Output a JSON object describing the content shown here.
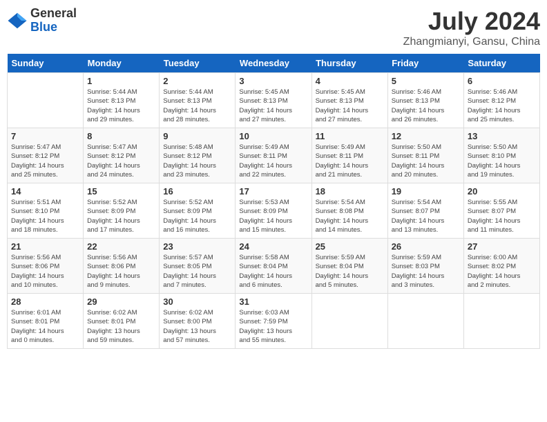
{
  "header": {
    "logo_general": "General",
    "logo_blue": "Blue",
    "title": "July 2024",
    "location": "Zhangmianyi, Gansu, China"
  },
  "days_of_week": [
    "Sunday",
    "Monday",
    "Tuesday",
    "Wednesday",
    "Thursday",
    "Friday",
    "Saturday"
  ],
  "weeks": [
    [
      {
        "day": "",
        "info": ""
      },
      {
        "day": "1",
        "info": "Sunrise: 5:44 AM\nSunset: 8:13 PM\nDaylight: 14 hours\nand 29 minutes."
      },
      {
        "day": "2",
        "info": "Sunrise: 5:44 AM\nSunset: 8:13 PM\nDaylight: 14 hours\nand 28 minutes."
      },
      {
        "day": "3",
        "info": "Sunrise: 5:45 AM\nSunset: 8:13 PM\nDaylight: 14 hours\nand 27 minutes."
      },
      {
        "day": "4",
        "info": "Sunrise: 5:45 AM\nSunset: 8:13 PM\nDaylight: 14 hours\nand 27 minutes."
      },
      {
        "day": "5",
        "info": "Sunrise: 5:46 AM\nSunset: 8:13 PM\nDaylight: 14 hours\nand 26 minutes."
      },
      {
        "day": "6",
        "info": "Sunrise: 5:46 AM\nSunset: 8:12 PM\nDaylight: 14 hours\nand 25 minutes."
      }
    ],
    [
      {
        "day": "7",
        "info": "Sunrise: 5:47 AM\nSunset: 8:12 PM\nDaylight: 14 hours\nand 25 minutes."
      },
      {
        "day": "8",
        "info": "Sunrise: 5:47 AM\nSunset: 8:12 PM\nDaylight: 14 hours\nand 24 minutes."
      },
      {
        "day": "9",
        "info": "Sunrise: 5:48 AM\nSunset: 8:12 PM\nDaylight: 14 hours\nand 23 minutes."
      },
      {
        "day": "10",
        "info": "Sunrise: 5:49 AM\nSunset: 8:11 PM\nDaylight: 14 hours\nand 22 minutes."
      },
      {
        "day": "11",
        "info": "Sunrise: 5:49 AM\nSunset: 8:11 PM\nDaylight: 14 hours\nand 21 minutes."
      },
      {
        "day": "12",
        "info": "Sunrise: 5:50 AM\nSunset: 8:11 PM\nDaylight: 14 hours\nand 20 minutes."
      },
      {
        "day": "13",
        "info": "Sunrise: 5:50 AM\nSunset: 8:10 PM\nDaylight: 14 hours\nand 19 minutes."
      }
    ],
    [
      {
        "day": "14",
        "info": "Sunrise: 5:51 AM\nSunset: 8:10 PM\nDaylight: 14 hours\nand 18 minutes."
      },
      {
        "day": "15",
        "info": "Sunrise: 5:52 AM\nSunset: 8:09 PM\nDaylight: 14 hours\nand 17 minutes."
      },
      {
        "day": "16",
        "info": "Sunrise: 5:52 AM\nSunset: 8:09 PM\nDaylight: 14 hours\nand 16 minutes."
      },
      {
        "day": "17",
        "info": "Sunrise: 5:53 AM\nSunset: 8:09 PM\nDaylight: 14 hours\nand 15 minutes."
      },
      {
        "day": "18",
        "info": "Sunrise: 5:54 AM\nSunset: 8:08 PM\nDaylight: 14 hours\nand 14 minutes."
      },
      {
        "day": "19",
        "info": "Sunrise: 5:54 AM\nSunset: 8:07 PM\nDaylight: 14 hours\nand 13 minutes."
      },
      {
        "day": "20",
        "info": "Sunrise: 5:55 AM\nSunset: 8:07 PM\nDaylight: 14 hours\nand 11 minutes."
      }
    ],
    [
      {
        "day": "21",
        "info": "Sunrise: 5:56 AM\nSunset: 8:06 PM\nDaylight: 14 hours\nand 10 minutes."
      },
      {
        "day": "22",
        "info": "Sunrise: 5:56 AM\nSunset: 8:06 PM\nDaylight: 14 hours\nand 9 minutes."
      },
      {
        "day": "23",
        "info": "Sunrise: 5:57 AM\nSunset: 8:05 PM\nDaylight: 14 hours\nand 7 minutes."
      },
      {
        "day": "24",
        "info": "Sunrise: 5:58 AM\nSunset: 8:04 PM\nDaylight: 14 hours\nand 6 minutes."
      },
      {
        "day": "25",
        "info": "Sunrise: 5:59 AM\nSunset: 8:04 PM\nDaylight: 14 hours\nand 5 minutes."
      },
      {
        "day": "26",
        "info": "Sunrise: 5:59 AM\nSunset: 8:03 PM\nDaylight: 14 hours\nand 3 minutes."
      },
      {
        "day": "27",
        "info": "Sunrise: 6:00 AM\nSunset: 8:02 PM\nDaylight: 14 hours\nand 2 minutes."
      }
    ],
    [
      {
        "day": "28",
        "info": "Sunrise: 6:01 AM\nSunset: 8:01 PM\nDaylight: 14 hours\nand 0 minutes."
      },
      {
        "day": "29",
        "info": "Sunrise: 6:02 AM\nSunset: 8:01 PM\nDaylight: 13 hours\nand 59 minutes."
      },
      {
        "day": "30",
        "info": "Sunrise: 6:02 AM\nSunset: 8:00 PM\nDaylight: 13 hours\nand 57 minutes."
      },
      {
        "day": "31",
        "info": "Sunrise: 6:03 AM\nSunset: 7:59 PM\nDaylight: 13 hours\nand 55 minutes."
      },
      {
        "day": "",
        "info": ""
      },
      {
        "day": "",
        "info": ""
      },
      {
        "day": "",
        "info": ""
      }
    ]
  ]
}
